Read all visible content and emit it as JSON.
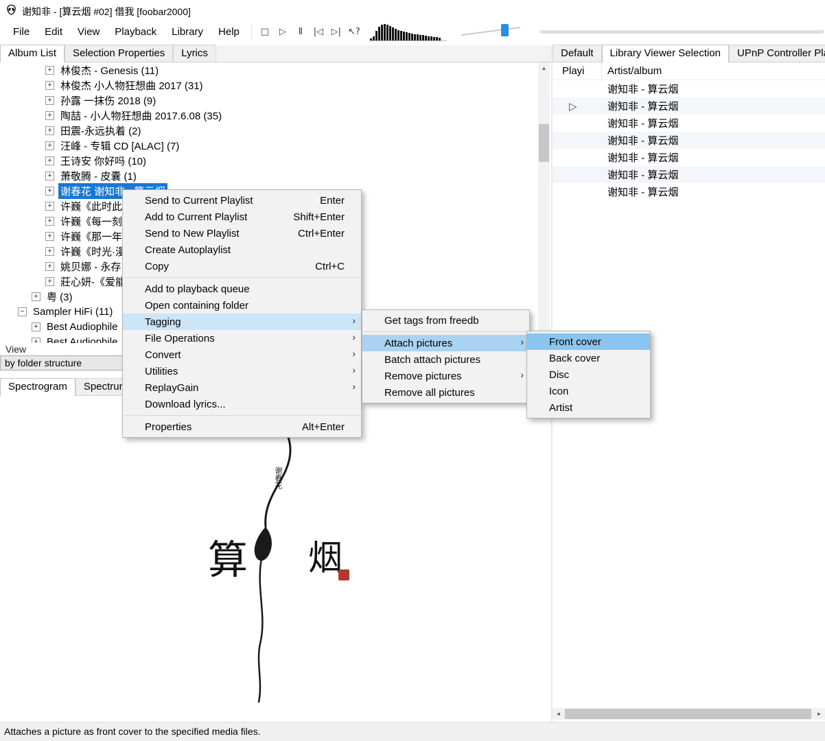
{
  "window": {
    "title": "谢知非 - [算云烟 #02] 借我  [foobar2000]"
  },
  "menubar": {
    "items": [
      "File",
      "Edit",
      "View",
      "Playback",
      "Library",
      "Help"
    ]
  },
  "toolbar": {
    "stop": "□",
    "play": "▷",
    "pause": "Ⅱ",
    "prev": "|◁",
    "next": "▷|",
    "help": "↖?",
    "spectrum_bars": [
      3,
      6,
      14,
      20,
      23,
      24,
      23,
      21,
      19,
      17,
      15,
      14,
      13,
      12,
      11,
      10,
      9,
      9,
      8,
      8,
      7,
      6,
      6,
      5,
      5,
      4
    ]
  },
  "left_tabs": {
    "items": [
      "Album List",
      "Selection Properties",
      "Lyrics"
    ]
  },
  "right_tabs": {
    "items": [
      "Default",
      "Library Viewer Selection",
      "UPnP Controller Pla"
    ]
  },
  "tree": {
    "items": [
      {
        "label": "林俊杰 - Genesis (11)",
        "expander": "+"
      },
      {
        "label": "林俊杰 小人物狂想曲 2017 (31)",
        "expander": "+"
      },
      {
        "label": "孙露 一抹伤 2018 (9)",
        "expander": "+"
      },
      {
        "label": "陶喆 - 小人物狂想曲 2017.6.08 (35)",
        "expander": "+"
      },
      {
        "label": "田震-永远执着 (2)",
        "expander": "+"
      },
      {
        "label": "汪峰 - 专辑 CD [ALAC] (7)",
        "expander": "+"
      },
      {
        "label": "王诗安 你好吗 (10)",
        "expander": "+"
      },
      {
        "label": "萧敬腾 - 皮囊 (1)",
        "expander": "+"
      },
      {
        "label": "谢春花 谢知非 - 算云烟",
        "expander": "+"
      },
      {
        "label": "许巍《此时此刻",
        "expander": "+"
      },
      {
        "label": "许巍《每一刻都",
        "expander": "+"
      },
      {
        "label": "许巍《那一年》",
        "expander": "+"
      },
      {
        "label": "许巍《时光·漫步",
        "expander": "+"
      },
      {
        "label": "姚贝娜 - 永存 (",
        "expander": "+"
      },
      {
        "label": "莊心妍-《爱能",
        "expander": "+"
      },
      {
        "label": "粤 (3)",
        "expander": "+"
      },
      {
        "label": "Sampler HiFi (11)",
        "expander": "−"
      },
      {
        "label": "Best Audiophile",
        "expander": "+"
      },
      {
        "label": "Best Audiophile",
        "expander": "+"
      }
    ]
  },
  "view_panel": {
    "label": "View",
    "mode": "by folder structure",
    "arrow": "▾"
  },
  "bottom_tabs": {
    "items": [
      "Spectrogram",
      "Spectrum"
    ]
  },
  "artwork": {
    "char_left": "算",
    "char_right": "烟",
    "artist": "谢春花",
    "seal_color": "#b5382c"
  },
  "playlist": {
    "columns": [
      "Playi",
      "Artist/album"
    ],
    "rows": [
      {
        "indicator": "",
        "title": "谢知非 - 算云烟"
      },
      {
        "indicator": "▷",
        "title": "谢知非 - 算云烟"
      },
      {
        "indicator": "",
        "title": "谢知非 - 算云烟"
      },
      {
        "indicator": "",
        "title": "谢知非 - 算云烟"
      },
      {
        "indicator": "",
        "title": "谢知非 - 算云烟"
      },
      {
        "indicator": "",
        "title": "谢知非 - 算云烟"
      },
      {
        "indicator": "",
        "title": "谢知非 - 算云烟"
      }
    ]
  },
  "context_menu": {
    "items": [
      {
        "label": "Send to Current Playlist",
        "shortcut": "Enter"
      },
      {
        "label": "Add to Current Playlist",
        "shortcut": "Shift+Enter"
      },
      {
        "label": "Send to New Playlist",
        "shortcut": "Ctrl+Enter"
      },
      {
        "label": "Create Autoplaylist",
        "shortcut": ""
      },
      {
        "label": "Copy",
        "shortcut": "Ctrl+C"
      },
      {
        "label": "Add to playback queue",
        "shortcut": ""
      },
      {
        "label": "Open containing folder",
        "shortcut": ""
      },
      {
        "label": "Tagging",
        "arrow": "›"
      },
      {
        "label": "File Operations",
        "arrow": "›"
      },
      {
        "label": "Convert",
        "arrow": "›"
      },
      {
        "label": "Utilities",
        "arrow": "›"
      },
      {
        "label": "ReplayGain",
        "arrow": "›"
      },
      {
        "label": "Download lyrics...",
        "shortcut": ""
      },
      {
        "label": "Properties",
        "shortcut": "Alt+Enter"
      }
    ]
  },
  "tagging_menu": {
    "items": [
      {
        "label": "Get tags from freedb"
      },
      {
        "label": "Attach pictures",
        "arrow": "›"
      },
      {
        "label": "Batch attach pictures"
      },
      {
        "label": "Remove pictures",
        "arrow": "›"
      },
      {
        "label": "Remove all pictures"
      }
    ]
  },
  "attach_menu": {
    "items": [
      {
        "label": "Front cover"
      },
      {
        "label": "Back cover"
      },
      {
        "label": "Disc"
      },
      {
        "label": "Icon"
      },
      {
        "label": "Artist"
      }
    ]
  },
  "scrollbars": {
    "up": "▲",
    "down": "▼",
    "left": "◄",
    "right": "►"
  },
  "statusbar": {
    "text": "Attaches a picture as front cover to the specified media files."
  }
}
